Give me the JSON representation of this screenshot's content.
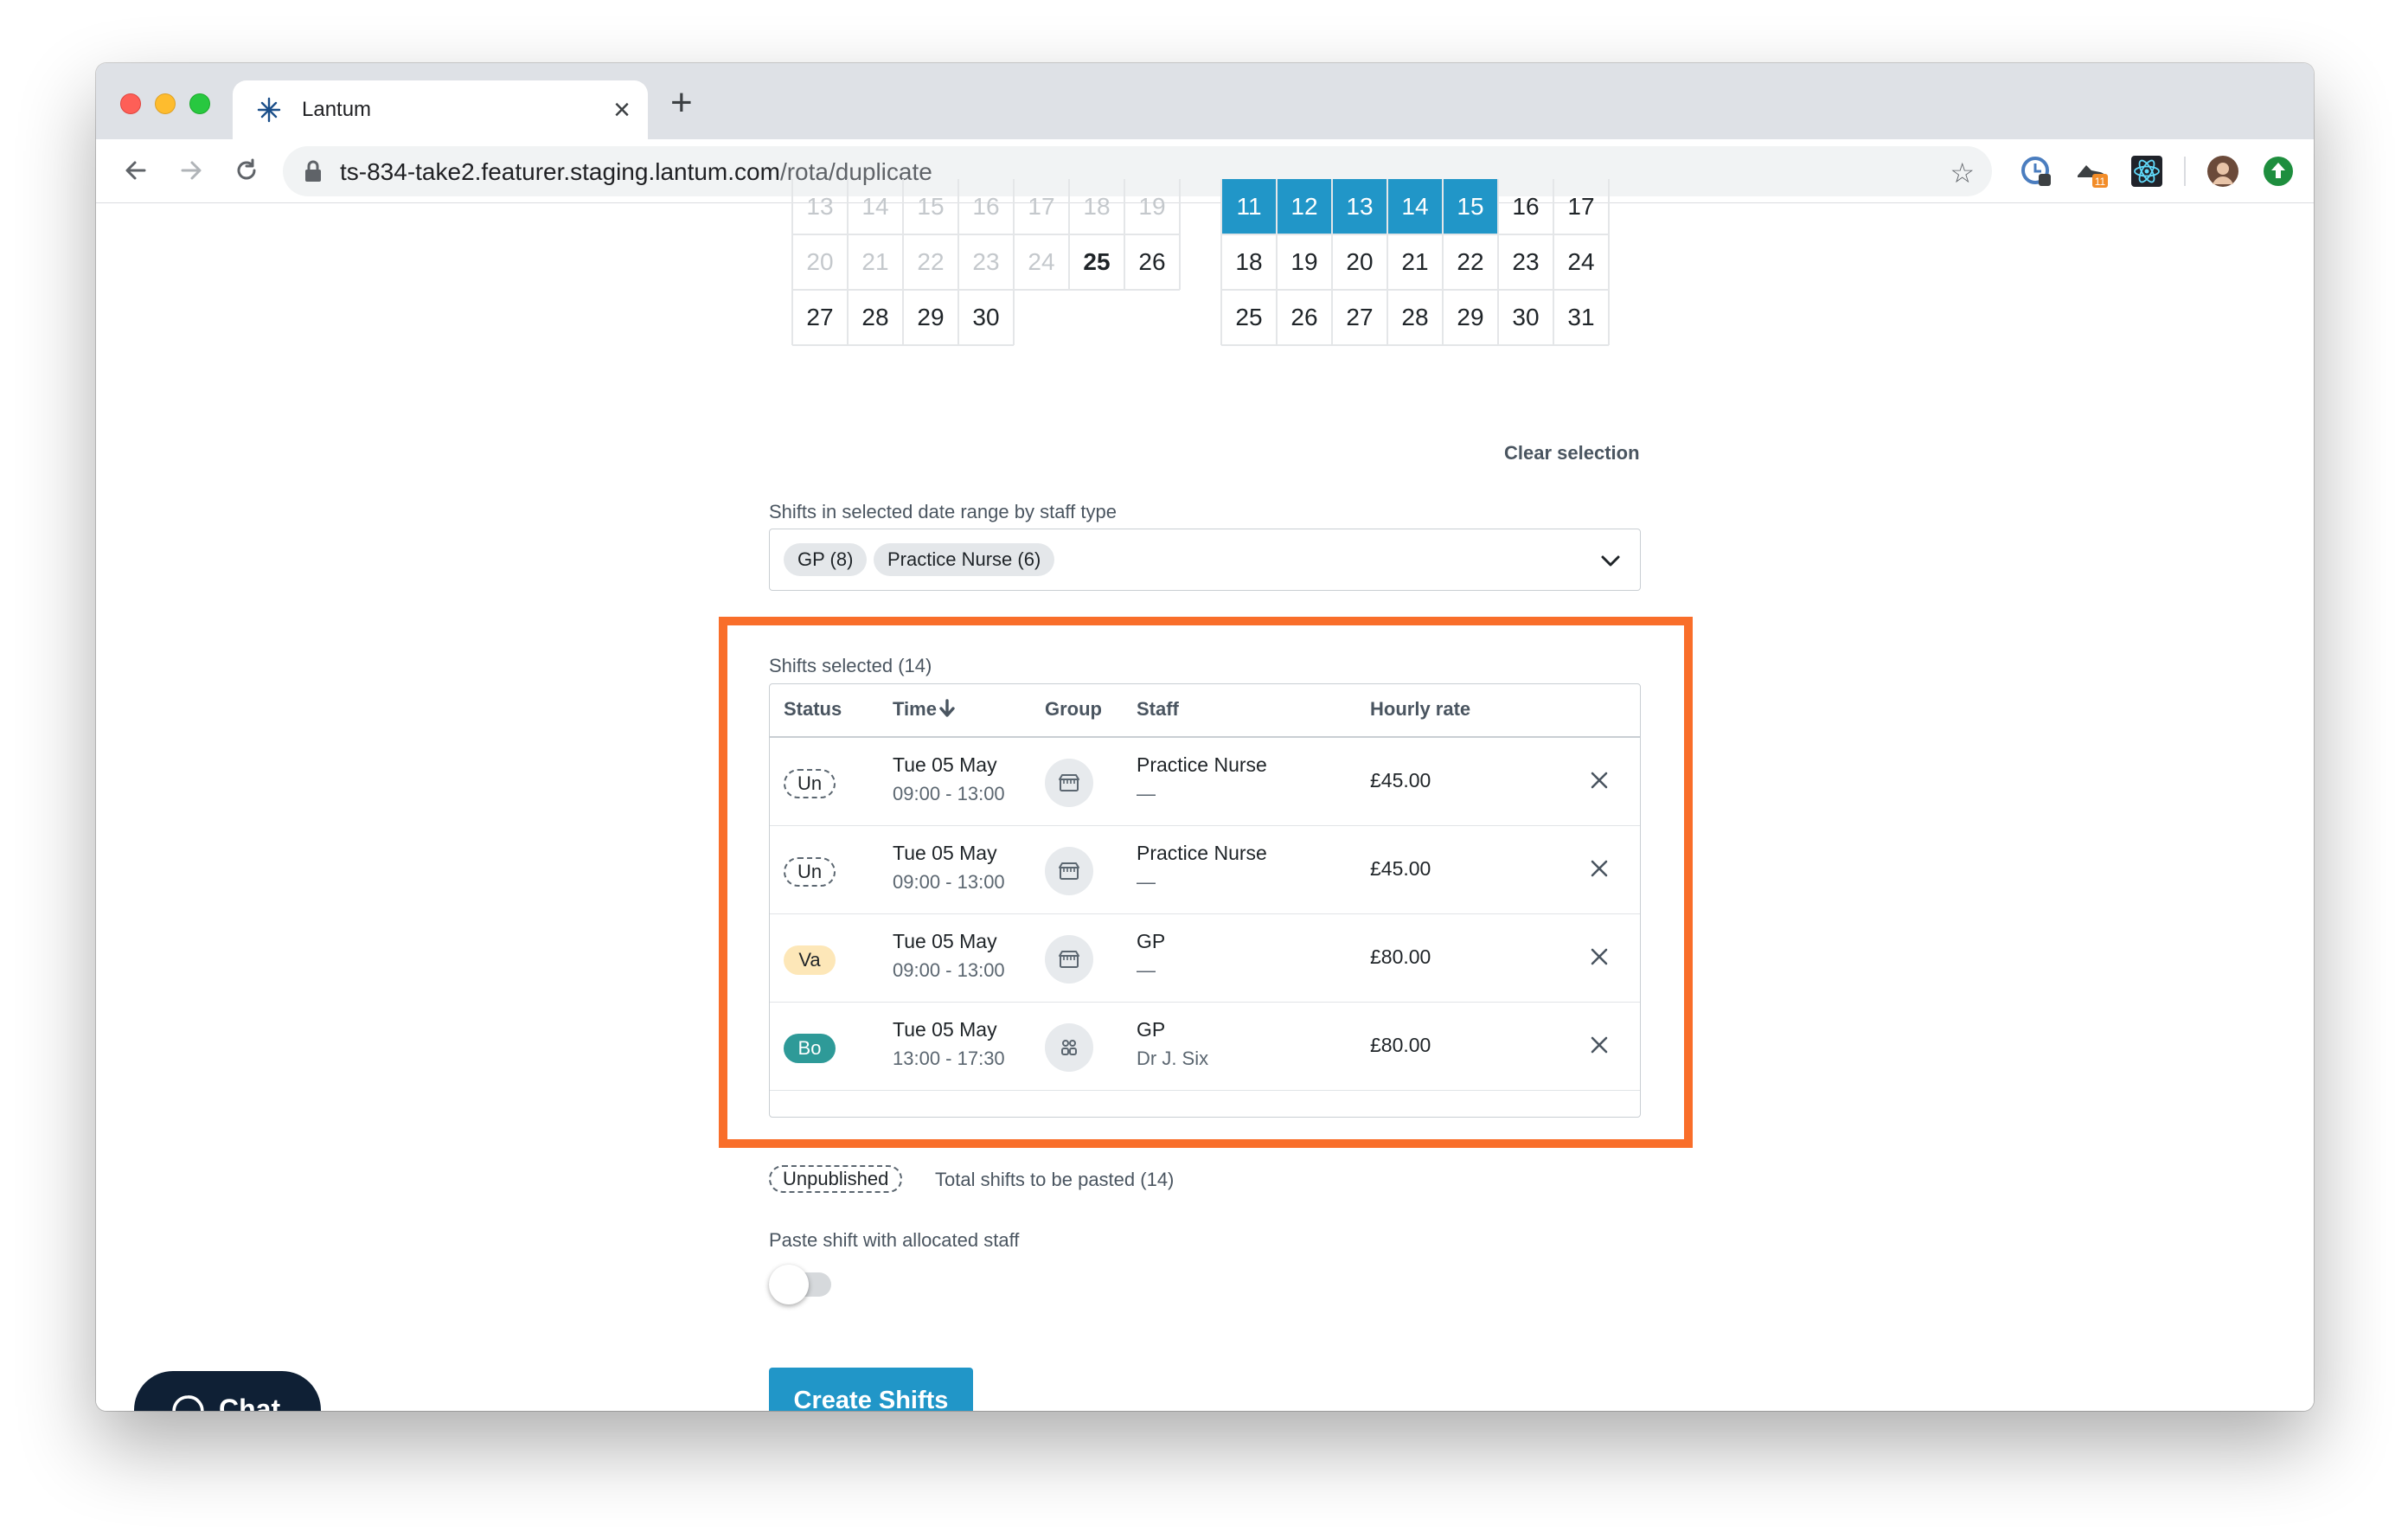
{
  "browser": {
    "tab_title": "Lantum",
    "url_domain": "ts-834-take2.featurer.staging.lantum.com",
    "url_path": "/rota/duplicate",
    "extension_badge": "11"
  },
  "calendar_left": {
    "rows": [
      [
        {
          "d": "13",
          "s": "muted"
        },
        {
          "d": "14",
          "s": "muted"
        },
        {
          "d": "15",
          "s": "muted"
        },
        {
          "d": "16",
          "s": "muted"
        },
        {
          "d": "17",
          "s": "muted"
        },
        {
          "d": "18",
          "s": "muted"
        },
        {
          "d": "19",
          "s": "muted"
        }
      ],
      [
        {
          "d": "20",
          "s": "muted"
        },
        {
          "d": "21",
          "s": "muted"
        },
        {
          "d": "22",
          "s": "muted"
        },
        {
          "d": "23",
          "s": "muted"
        },
        {
          "d": "24",
          "s": "muted"
        },
        {
          "d": "25",
          "s": "bold"
        },
        {
          "d": "26",
          "s": "normal"
        }
      ],
      [
        {
          "d": "27",
          "s": "normal"
        },
        {
          "d": "28",
          "s": "normal"
        },
        {
          "d": "29",
          "s": "normal"
        },
        {
          "d": "30",
          "s": "normal"
        }
      ]
    ]
  },
  "calendar_right": {
    "rows": [
      [
        {
          "d": "11",
          "s": "sel"
        },
        {
          "d": "12",
          "s": "sel"
        },
        {
          "d": "13",
          "s": "sel"
        },
        {
          "d": "14",
          "s": "sel"
        },
        {
          "d": "15",
          "s": "sel"
        },
        {
          "d": "16",
          "s": "normal"
        },
        {
          "d": "17",
          "s": "normal"
        }
      ],
      [
        {
          "d": "18",
          "s": "normal"
        },
        {
          "d": "19",
          "s": "normal"
        },
        {
          "d": "20",
          "s": "normal"
        },
        {
          "d": "21",
          "s": "normal"
        },
        {
          "d": "22",
          "s": "normal"
        },
        {
          "d": "23",
          "s": "normal"
        },
        {
          "d": "24",
          "s": "normal"
        }
      ],
      [
        {
          "d": "25",
          "s": "normal"
        },
        {
          "d": "26",
          "s": "normal"
        },
        {
          "d": "27",
          "s": "normal"
        },
        {
          "d": "28",
          "s": "normal"
        },
        {
          "d": "29",
          "s": "normal"
        },
        {
          "d": "30",
          "s": "normal"
        },
        {
          "d": "31",
          "s": "normal"
        }
      ]
    ]
  },
  "clear_selection": "Clear selection",
  "staff_type": {
    "label": "Shifts in selected date range by staff type",
    "chips": [
      "GP (8)",
      "Practice Nurse (6)"
    ]
  },
  "shifts": {
    "label": "Shifts selected (14)",
    "headers": {
      "status": "Status",
      "time": "Time",
      "group": "Group",
      "staff": "Staff",
      "rate": "Hourly rate"
    },
    "rows": [
      {
        "status": "Un",
        "kind": "un",
        "date": "Tue 05 May",
        "time": "09:00 - 13:00",
        "group_icon": "building-icon",
        "staff": "Practice Nurse",
        "staff_name": "—",
        "rate": "£45.00"
      },
      {
        "status": "Un",
        "kind": "un",
        "date": "Tue 05 May",
        "time": "09:00 - 13:00",
        "group_icon": "building-icon",
        "staff": "Practice Nurse",
        "staff_name": "—",
        "rate": "£45.00"
      },
      {
        "status": "Va",
        "kind": "va",
        "date": "Tue 05 May",
        "time": "09:00 - 13:00",
        "group_icon": "building-icon",
        "staff": "GP",
        "staff_name": "—",
        "rate": "£80.00"
      },
      {
        "status": "Bo",
        "kind": "bo",
        "date": "Tue 05 May",
        "time": "13:00 - 17:30",
        "group_icon": "people-group-icon",
        "staff": "GP",
        "staff_name": "Dr J. Six",
        "rate": "£80.00"
      }
    ]
  },
  "summary": {
    "badge": "Unpublished",
    "total": "Total shifts to be pasted (14)"
  },
  "paste_toggle": {
    "label": "Paste shift with allocated staff",
    "on": false
  },
  "create_button": "Create Shifts",
  "chat_button": "Chat",
  "colors": {
    "accent": "#2196c8",
    "highlight": "#f96e2a",
    "vacant": "#fde7b8",
    "booked": "#2e9a98",
    "chat_bg": "#0f2035"
  }
}
